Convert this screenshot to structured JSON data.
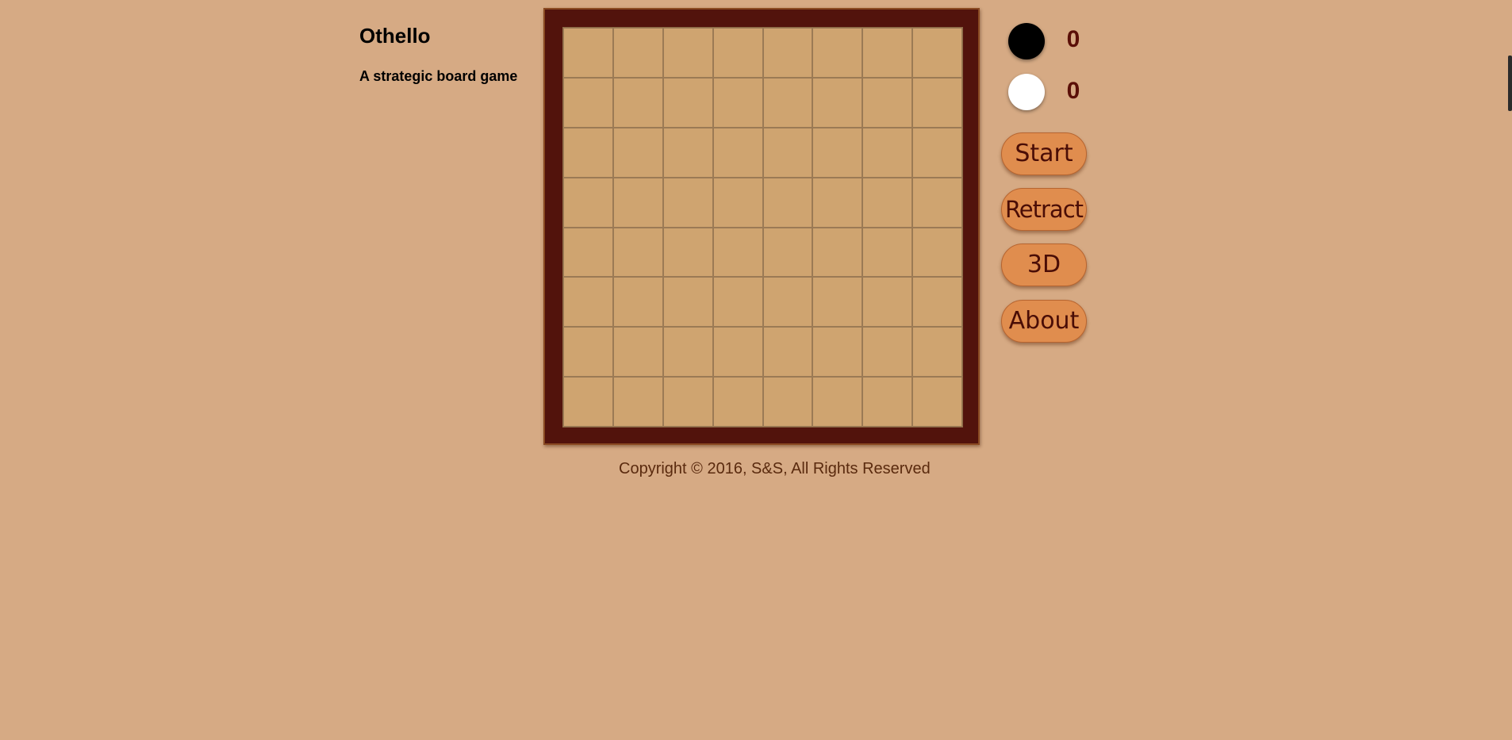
{
  "header": {
    "title": "Othello",
    "subtitle": "A strategic board game"
  },
  "board": {
    "rows": 8,
    "columns": 8,
    "colors": {
      "frame": "#52130c",
      "cell": "#cfa470",
      "grid_line": "#9b7a55"
    }
  },
  "scores": {
    "black": {
      "value": "0",
      "disc_color": "#000000"
    },
    "white": {
      "value": "0",
      "disc_color": "#ffffff"
    }
  },
  "controls": {
    "start_label": "Start",
    "retract_label": "Retract",
    "view3d_label": "3D",
    "about_label": "About"
  },
  "footer": {
    "copyright": "Copyright © 2016, S&S, All Rights Reserved"
  },
  "colors": {
    "background": "#d6aa84",
    "button": "#e08d4e",
    "button_text": "#4a0d06",
    "score_text": "#5a0f08"
  }
}
